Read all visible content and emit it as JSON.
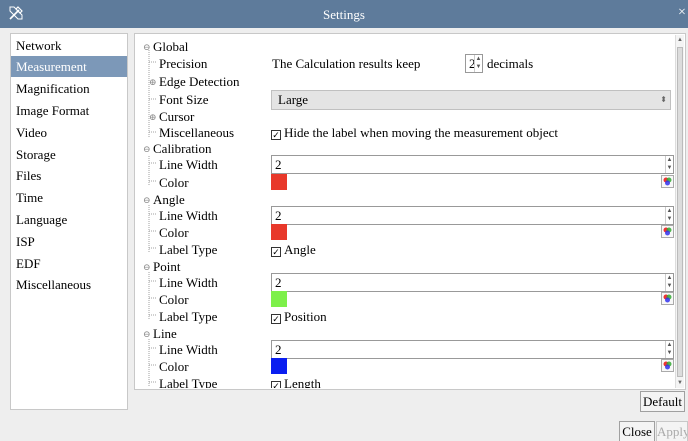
{
  "window": {
    "title": "Settings",
    "close_glyph": "×"
  },
  "sidebar": {
    "items": [
      {
        "label": "Network"
      },
      {
        "label": "Measurement",
        "selected": true
      },
      {
        "label": "Magnification"
      },
      {
        "label": "Image Format"
      },
      {
        "label": "Video"
      },
      {
        "label": "Storage"
      },
      {
        "label": "Files"
      },
      {
        "label": "Time"
      },
      {
        "label": "Language"
      },
      {
        "label": "ISP"
      },
      {
        "label": "EDF"
      },
      {
        "label": "Miscellaneous"
      }
    ]
  },
  "tree": {
    "global": {
      "label": "Global",
      "precision_label": "Precision",
      "precision_text": "The Calculation results keep",
      "precision_value": "2",
      "precision_suffix": "decimals",
      "edge_detection_label": "Edge Detection",
      "font_size_label": "Font Size",
      "font_size_value": "Large",
      "cursor_label": "Cursor",
      "misc_label": "Miscellaneous",
      "misc_checkbox_label": "Hide the label when moving the measurement object"
    },
    "calibration": {
      "label": "Calibration",
      "line_width_label": "Line Width",
      "line_width_value": "2",
      "color_label": "Color",
      "color": "#e8382a"
    },
    "angle": {
      "label": "Angle",
      "line_width_label": "Line Width",
      "line_width_value": "2",
      "color_label": "Color",
      "color": "#e8382a",
      "label_type_label": "Label Type",
      "label_type_value": "Angle"
    },
    "point": {
      "label": "Point",
      "line_width_label": "Line Width",
      "line_width_value": "2",
      "color_label": "Color",
      "color": "#7df04a",
      "label_type_label": "Label Type",
      "label_type_value": "Position"
    },
    "line": {
      "label": "Line",
      "line_width_label": "Line Width",
      "line_width_value": "2",
      "color_label": "Color",
      "color": "#0a1ef0",
      "label_type_label": "Label Type",
      "label_type_value": "Length"
    }
  },
  "buttons": {
    "default": "Default",
    "close": "Close",
    "apply": "Apply"
  },
  "colors": {
    "titlebar": "#5e7b9b",
    "selection": "#7c98b8"
  }
}
